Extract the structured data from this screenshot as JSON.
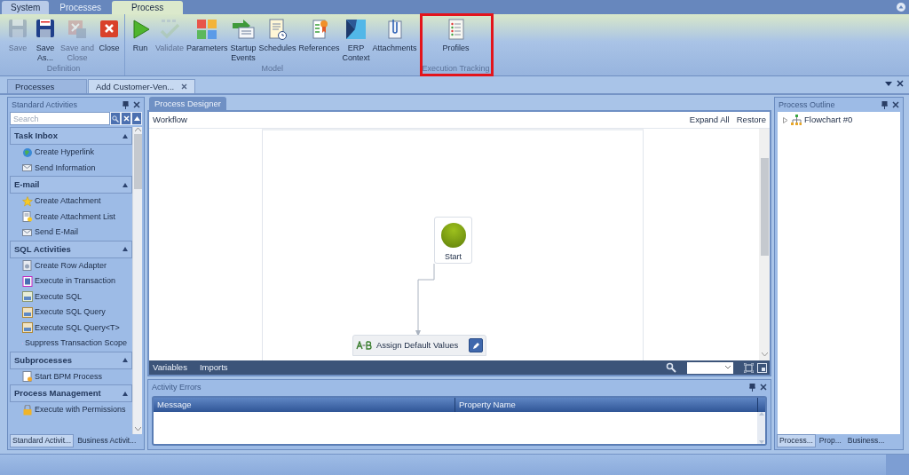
{
  "app_tabs": [
    {
      "label": "System",
      "selected": false
    },
    {
      "label": "Processes",
      "selected": false
    },
    {
      "label": "Process",
      "selected": true
    }
  ],
  "ribbon": {
    "groups": [
      {
        "title": "Definition",
        "highlighted": false,
        "buttons": [
          {
            "label": "Save",
            "disabled": true
          },
          {
            "label": "Save\nAs...",
            "disabled": false
          },
          {
            "label": "Save and\nClose",
            "disabled": true
          },
          {
            "label": "Close",
            "disabled": false
          }
        ]
      },
      {
        "title": "Model",
        "highlighted": false,
        "buttons": [
          {
            "label": "Run",
            "disabled": false
          },
          {
            "label": "Validate",
            "disabled": true
          },
          {
            "label": "Parameters",
            "disabled": false
          },
          {
            "label": "Startup\nEvents",
            "disabled": false
          },
          {
            "label": "Schedules",
            "disabled": false
          },
          {
            "label": "References",
            "disabled": false
          },
          {
            "label": "ERP\nContext",
            "disabled": false
          },
          {
            "label": "Attachments",
            "disabled": false
          }
        ]
      },
      {
        "title": "Execution Tracking",
        "highlighted": true,
        "buttons": [
          {
            "label": "Profiles",
            "disabled": false
          }
        ]
      }
    ]
  },
  "document_tabs": [
    {
      "label": "Processes",
      "selected": false,
      "closable": false
    },
    {
      "label": "Add Customer-Ven...",
      "selected": true,
      "closable": true
    }
  ],
  "left_panel": {
    "title": "Standard Activities",
    "search": {
      "placeholder": "Search"
    },
    "groups": [
      {
        "title": "Task Inbox",
        "expanded": true,
        "items": [
          "Create Hyperlink",
          "Send Information"
        ]
      },
      {
        "title": "E-mail",
        "expanded": true,
        "items": [
          "Create Attachment",
          "Create Attachment List",
          "Send E-Mail"
        ]
      },
      {
        "title": "SQL Activities",
        "expanded": true,
        "items": [
          "Create Row Adapter",
          "Execute in Transaction",
          "Execute SQL",
          "Execute SQL Query",
          "Execute SQL Query<T>",
          "Suppress Transaction Scope"
        ]
      },
      {
        "title": "Subprocesses",
        "expanded": true,
        "items": [
          "Start BPM Process"
        ]
      },
      {
        "title": "Process Management",
        "expanded": true,
        "items": [
          "Execute with Permissions"
        ]
      }
    ],
    "bottom_tabs": [
      {
        "label": "Standard Activit...",
        "selected": true
      },
      {
        "label": "Business Activit...",
        "selected": false
      }
    ]
  },
  "designer": {
    "tab": "Process Designer",
    "header": "Workflow",
    "actions": [
      "Expand All",
      "Restore"
    ],
    "nodes": [
      {
        "kind": "start",
        "label": "Start"
      },
      {
        "kind": "activity",
        "label": "Assign Default Values"
      }
    ],
    "footer_tabs": [
      "Variables",
      "Imports"
    ]
  },
  "errors_panel": {
    "title": "Activity Errors",
    "columns": [
      "Message",
      "Property Name"
    ]
  },
  "outline": {
    "title": "Process Outline",
    "tree": [
      {
        "label": "Flowchart #0",
        "expanded": false
      }
    ],
    "bottom_tabs": [
      {
        "label": "Process...",
        "selected": true
      },
      {
        "label": "Prop...",
        "selected": false
      },
      {
        "label": "Business...",
        "selected": false
      }
    ]
  }
}
